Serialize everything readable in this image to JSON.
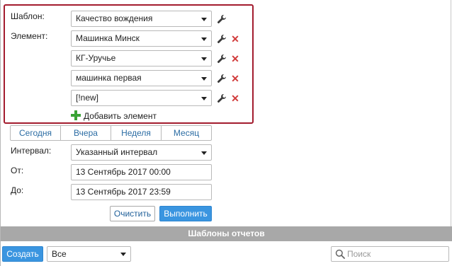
{
  "form": {
    "template_label": "Шаблон:",
    "template_value": "Качество вождения",
    "element_label": "Элемент:",
    "elements": [
      {
        "value": "Машинка Минск"
      },
      {
        "value": "КГ-Уручье"
      },
      {
        "value": "машинка первая"
      },
      {
        "value": "[!new]"
      }
    ],
    "add_element_label": "Добавить элемент",
    "periods": [
      "Сегодня",
      "Вчера",
      "Неделя",
      "Месяц"
    ],
    "interval_label": "Интервал:",
    "interval_value": "Указанный интервал",
    "from_label": "От:",
    "from_value": "13 Сентябрь 2017 00:00",
    "to_label": "До:",
    "to_value": "13 Сентябрь 2017 23:59",
    "clear_label": "Очистить",
    "run_label": "Выполнить"
  },
  "templates_section": {
    "title": "Шаблоны отчетов",
    "create_label": "Создать",
    "filter_value": "Все",
    "search_placeholder": "Поиск"
  },
  "colors": {
    "highlight": "#a31c2e",
    "primary_button": "#3a95e0",
    "delete": "#d13b3b",
    "add": "#3aa335"
  }
}
